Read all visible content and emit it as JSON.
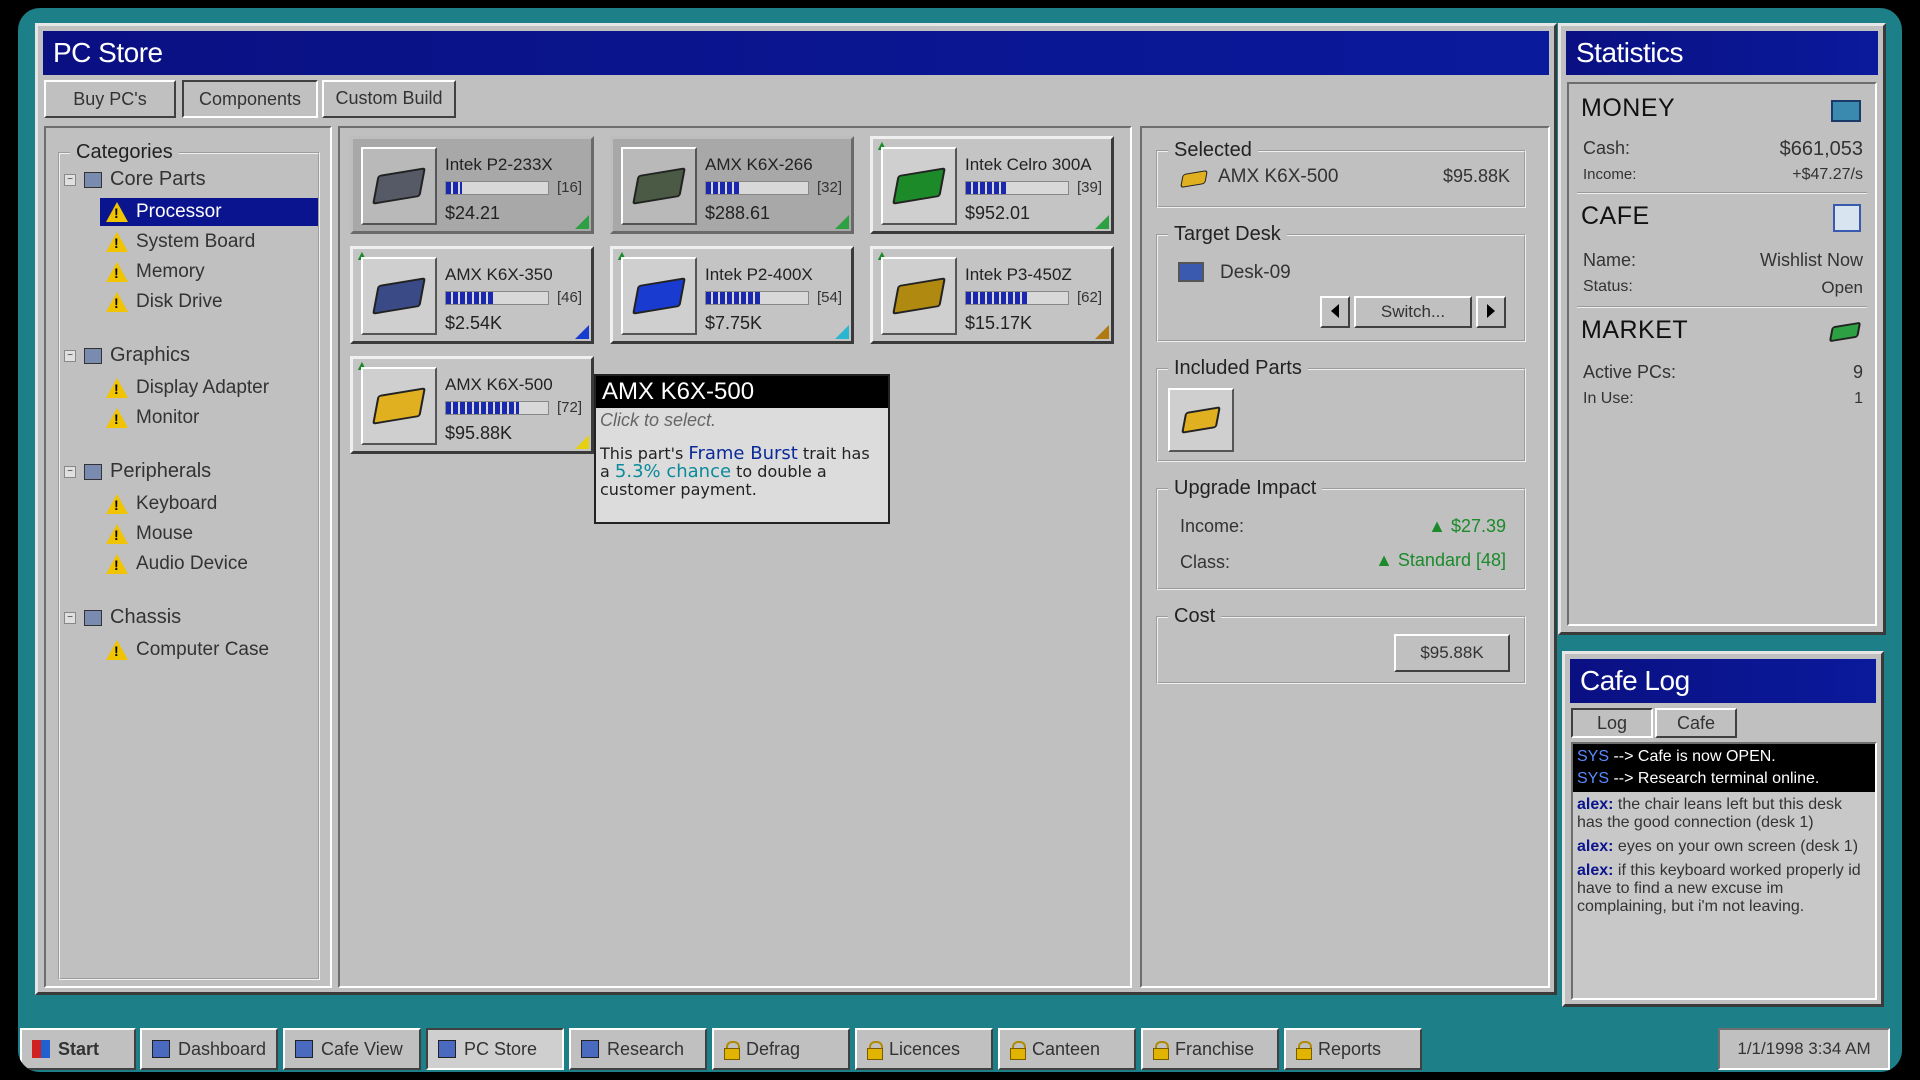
{
  "pc_store": {
    "title": "PC Store",
    "tabs": [
      {
        "label": "Buy PC's"
      },
      {
        "label": "Components"
      },
      {
        "label": "Custom Build"
      }
    ],
    "categories_label": "Categories",
    "categories": [
      {
        "label": "Core Parts",
        "items": [
          "Processor",
          "System Board",
          "Memory",
          "Disk Drive"
        ]
      },
      {
        "label": "Graphics",
        "items": [
          "Display Adapter",
          "Monitor"
        ]
      },
      {
        "label": "Peripherals",
        "items": [
          "Keyboard",
          "Mouse",
          "Audio Device"
        ]
      },
      {
        "label": "Chassis",
        "items": [
          "Computer Case"
        ]
      }
    ],
    "selected_category": "Processor",
    "parts": [
      {
        "name": "Intek P2-233X",
        "level": "[16]",
        "fill": 0.16,
        "price": "$24.21",
        "chip": "#555a66",
        "corner": "#2da043"
      },
      {
        "name": "AMX K6X-266",
        "level": "[32]",
        "fill": 0.32,
        "price": "$288.61",
        "chip": "#4a5a44",
        "corner": "#2da043"
      },
      {
        "name": "Intek Celro 300A",
        "level": "[39]",
        "fill": 0.39,
        "price": "$952.01",
        "chip": "#1d8a2a",
        "corner": "#2da043"
      },
      {
        "name": "AMX K6X-350",
        "level": "[46]",
        "fill": 0.46,
        "price": "$2.54K",
        "chip": "#3a4a86",
        "corner": "#1a3bd0"
      },
      {
        "name": "Intek P2-400X",
        "level": "[54]",
        "fill": 0.54,
        "price": "$7.75K",
        "chip": "#1a3bd0",
        "corner": "#2ab6d0"
      },
      {
        "name": "Intek P3-450Z",
        "level": "[62]",
        "fill": 0.62,
        "price": "$15.17K",
        "chip": "#b08a10",
        "corner": "#b07a10"
      },
      {
        "name": "AMX K6X-500",
        "level": "[72]",
        "fill": 0.72,
        "price": "$95.88K",
        "chip": "#e0b020",
        "corner": "#e6d010"
      }
    ],
    "tooltip": {
      "title": "AMX K6X-500",
      "hint": "Click to select.",
      "text_a": "This part's ",
      "trait": "Frame Burst",
      "text_b": " trait has a ",
      "chance": "5.3% chance",
      "text_c": " to double a customer payment."
    },
    "selected": {
      "label": "Selected",
      "name": "AMX K6X-500",
      "price": "$95.88K"
    },
    "target_desk": {
      "label": "Target Desk",
      "desk": "Desk-09",
      "switch_label": "Switch..."
    },
    "included_parts_label": "Included Parts",
    "upgrade_impact": {
      "label": "Upgrade Impact",
      "income_label": "Income:",
      "income_value": "▲ $27.39",
      "class_label": "Class:",
      "class_value": "▲ Standard [48]"
    },
    "cost": {
      "label": "Cost",
      "value": "$95.88K"
    }
  },
  "statistics": {
    "title": "Statistics",
    "money": {
      "heading": "MONEY",
      "cash_label": "Cash:",
      "cash": "$661,053",
      "income_label": "Income:",
      "income": "+$47.27/s"
    },
    "cafe": {
      "heading": "CAFE",
      "name_label": "Name:",
      "name": "Wishlist Now",
      "status_label": "Status:",
      "status": "Open"
    },
    "market": {
      "heading": "MARKET",
      "active_label": "Active PCs:",
      "active": "9",
      "inuse_label": "In Use:",
      "inuse": "1"
    }
  },
  "cafe_log": {
    "title": "Cafe Log",
    "tabs": [
      {
        "label": "Log"
      },
      {
        "label": "Cafe"
      }
    ],
    "sys": [
      {
        "tag": "SYS",
        "text": " --> Cafe is now OPEN."
      },
      {
        "tag": "SYS",
        "text": " --> Research terminal online."
      }
    ],
    "messages": [
      {
        "user": "alex:",
        "text": " the chair leans left but this desk has the good connection (desk 1)"
      },
      {
        "user": "alex:",
        "text": " eyes on your own screen (desk 1)"
      },
      {
        "user": "alex:",
        "text": " if this keyboard worked properly id have to find a new excuse im complaining, but i'm not leaving."
      }
    ]
  },
  "taskbar": {
    "start": "Start",
    "items": [
      {
        "label": "Dashboard",
        "locked": false
      },
      {
        "label": "Cafe View",
        "locked": false
      },
      {
        "label": "PC Store",
        "locked": false
      },
      {
        "label": "Research",
        "locked": false
      },
      {
        "label": "Defrag",
        "locked": true
      },
      {
        "label": "Licences",
        "locked": true
      },
      {
        "label": "Canteen",
        "locked": true
      },
      {
        "label": "Franchise",
        "locked": true
      },
      {
        "label": "Reports",
        "locked": true
      }
    ],
    "clock": "1/1/1998 3:34 AM"
  }
}
